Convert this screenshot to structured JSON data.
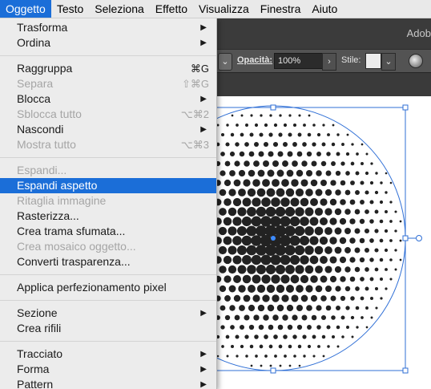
{
  "menubar": {
    "items": [
      "Oggetto",
      "Testo",
      "Seleziona",
      "Effetto",
      "Visualizza",
      "Finestra",
      "Aiuto"
    ],
    "active_index": 0
  },
  "app": {
    "name_fragment": "Adob"
  },
  "control_bar": {
    "opacity_label": "Opacità:",
    "opacity_value": "100%",
    "style_label": "Stile:",
    "arrow_glyph": "›",
    "dropdown_glyph": "⌄"
  },
  "menu": {
    "items": [
      {
        "label": "Trasforma",
        "submenu": true
      },
      {
        "label": "Ordina",
        "submenu": true
      },
      {
        "separator": true
      },
      {
        "label": "Raggruppa",
        "shortcut": "⌘G"
      },
      {
        "label": "Separa",
        "shortcut": "⇧⌘G",
        "disabled": true
      },
      {
        "label": "Blocca",
        "submenu": true
      },
      {
        "label": "Sblocca tutto",
        "shortcut": "⌥⌘2",
        "disabled": true
      },
      {
        "label": "Nascondi",
        "submenu": true
      },
      {
        "label": "Mostra tutto",
        "shortcut": "⌥⌘3",
        "disabled": true
      },
      {
        "separator": true
      },
      {
        "label": "Espandi...",
        "disabled": true
      },
      {
        "label": "Espandi aspetto",
        "selected": true
      },
      {
        "label": "Ritaglia immagine",
        "disabled": true
      },
      {
        "label": "Rasterizza..."
      },
      {
        "label": "Crea trama sfumata..."
      },
      {
        "label": "Crea mosaico oggetto...",
        "disabled": true
      },
      {
        "label": "Converti trasparenza..."
      },
      {
        "separator": true
      },
      {
        "label": "Applica perfezionamento pixel"
      },
      {
        "separator": true
      },
      {
        "label": "Sezione",
        "submenu": true
      },
      {
        "label": "Crea rifili"
      },
      {
        "separator": true
      },
      {
        "label": "Tracciato",
        "submenu": true
      },
      {
        "label": "Forma",
        "submenu": true
      },
      {
        "label": "Pattern",
        "submenu": true
      }
    ],
    "submenu_glyph": "▶"
  },
  "artwork": {
    "description_color": "#222222",
    "selection_color": "#2f6fd6"
  },
  "colors": {
    "menubar_bg": "#e9e9e9",
    "highlight": "#1b6ed8",
    "app_dark": "#3b3b3b",
    "control_bar": "#535353"
  }
}
